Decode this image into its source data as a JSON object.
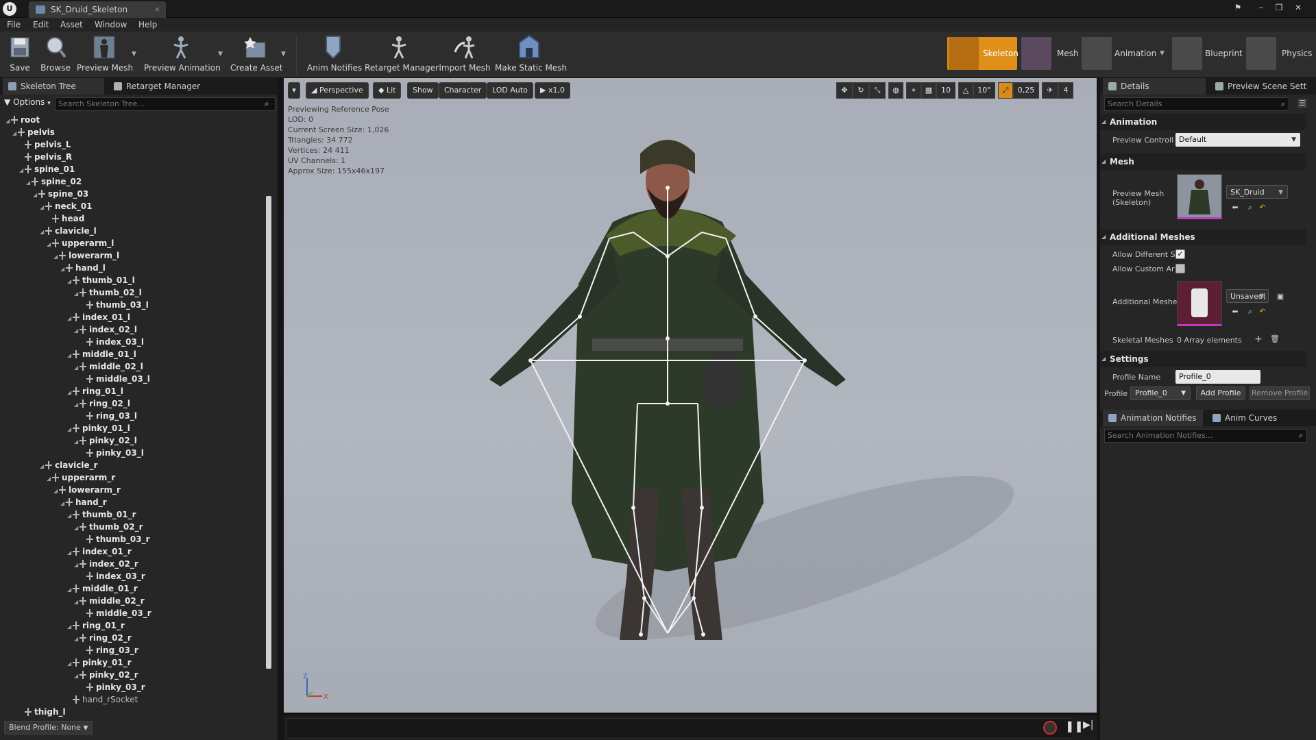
{
  "window": {
    "logo": "U",
    "tab_title": "SK_Druid_Skeleton",
    "tab_close": "×"
  },
  "menu": [
    "File",
    "Edit",
    "Asset",
    "Window",
    "Help"
  ],
  "toolbar": {
    "buttons": [
      {
        "label": "Save",
        "icon": "save-icon"
      },
      {
        "label": "Browse",
        "icon": "browse-icon"
      },
      {
        "label": "Preview Mesh",
        "icon": "preview-mesh-icon"
      },
      {
        "label": "Preview Animation",
        "icon": "preview-animation-icon"
      },
      {
        "label": "Create Asset",
        "icon": "create-asset-icon"
      },
      {
        "label": "Anim Notifies",
        "icon": "anim-notifies-icon"
      },
      {
        "label": "Retarget Manager",
        "icon": "retarget-manager-icon"
      },
      {
        "label": "Import Mesh",
        "icon": "import-mesh-icon"
      },
      {
        "label": "Make Static Mesh",
        "icon": "make-static-mesh-icon"
      }
    ],
    "modes": [
      "Skeleton",
      "Mesh",
      "Animation",
      "Blueprint",
      "Physics"
    ],
    "active_mode": "Skeleton",
    "active_color": "#e0901a"
  },
  "left_panel": {
    "tabs": [
      "Skeleton Tree",
      "Retarget Manager"
    ],
    "options_label": "Options",
    "search_placeholder": "Search Skeleton Tree...",
    "bones": [
      {
        "name": "root",
        "depth": 0
      },
      {
        "name": "pelvis",
        "depth": 1
      },
      {
        "name": "pelvis_L",
        "depth": 2
      },
      {
        "name": "pelvis_R",
        "depth": 2
      },
      {
        "name": "spine_01",
        "depth": 2
      },
      {
        "name": "spine_02",
        "depth": 3
      },
      {
        "name": "spine_03",
        "depth": 4
      },
      {
        "name": "neck_01",
        "depth": 5
      },
      {
        "name": "head",
        "depth": 6
      },
      {
        "name": "clavicle_l",
        "depth": 5
      },
      {
        "name": "upperarm_l",
        "depth": 6
      },
      {
        "name": "lowerarm_l",
        "depth": 7
      },
      {
        "name": "hand_l",
        "depth": 8
      },
      {
        "name": "thumb_01_l",
        "depth": 9
      },
      {
        "name": "thumb_02_l",
        "depth": 10
      },
      {
        "name": "thumb_03_l",
        "depth": 11
      },
      {
        "name": "index_01_l",
        "depth": 9
      },
      {
        "name": "index_02_l",
        "depth": 10
      },
      {
        "name": "index_03_l",
        "depth": 11
      },
      {
        "name": "middle_01_l",
        "depth": 9
      },
      {
        "name": "middle_02_l",
        "depth": 10
      },
      {
        "name": "middle_03_l",
        "depth": 11
      },
      {
        "name": "ring_01_l",
        "depth": 9
      },
      {
        "name": "ring_02_l",
        "depth": 10
      },
      {
        "name": "ring_03_l",
        "depth": 11
      },
      {
        "name": "pinky_01_l",
        "depth": 9
      },
      {
        "name": "pinky_02_l",
        "depth": 10
      },
      {
        "name": "pinky_03_l",
        "depth": 11
      },
      {
        "name": "clavicle_r",
        "depth": 5
      },
      {
        "name": "upperarm_r",
        "depth": 6
      },
      {
        "name": "lowerarm_r",
        "depth": 7
      },
      {
        "name": "hand_r",
        "depth": 8
      },
      {
        "name": "thumb_01_r",
        "depth": 9
      },
      {
        "name": "thumb_02_r",
        "depth": 10
      },
      {
        "name": "thumb_03_r",
        "depth": 11
      },
      {
        "name": "index_01_r",
        "depth": 9
      },
      {
        "name": "index_02_r",
        "depth": 10
      },
      {
        "name": "index_03_r",
        "depth": 11
      },
      {
        "name": "middle_01_r",
        "depth": 9
      },
      {
        "name": "middle_02_r",
        "depth": 10
      },
      {
        "name": "middle_03_r",
        "depth": 11
      },
      {
        "name": "ring_01_r",
        "depth": 9
      },
      {
        "name": "ring_02_r",
        "depth": 10
      },
      {
        "name": "ring_03_r",
        "depth": 11
      },
      {
        "name": "pinky_01_r",
        "depth": 9
      },
      {
        "name": "pinky_02_r",
        "depth": 10
      },
      {
        "name": "pinky_03_r",
        "depth": 11
      },
      {
        "name": "hand_rSocket",
        "depth": 9,
        "socket": true
      },
      {
        "name": "thigh_l",
        "depth": 2
      }
    ],
    "blend_profile": "Blend Profile: None"
  },
  "viewport": {
    "buttons": {
      "menu": "▾",
      "perspective": "Perspective",
      "lit": "Lit",
      "show": "Show",
      "character": "Character",
      "lod": "LOD Auto",
      "speed": "x1,0"
    },
    "snap": {
      "grid": "10",
      "rotation": "10°",
      "scale": "0,25",
      "camera_speed": "4"
    },
    "info": [
      "Previewing Reference Pose",
      "LOD: 0",
      "Current Screen Size: 1,026",
      "Triangles: 34 772",
      "Vertices: 24 411",
      "UV Channels: 1",
      "Approx Size: 155x46x197"
    ],
    "axis": {
      "z": "Z",
      "x": "X"
    }
  },
  "right_panel": {
    "tabs": [
      "Details",
      "Preview Scene Sett"
    ],
    "search_placeholder": "Search Details",
    "sections": {
      "animation": "Animation",
      "mesh": "Mesh",
      "additional_meshes": "Additional Meshes",
      "settings": "Settings"
    },
    "preview_controller_label": "Preview Controll",
    "preview_controller_value": "Default",
    "preview_mesh_label": "Preview Mesh (Skeleton)",
    "preview_mesh_value": "SK_Druid",
    "allow_different_label": "Allow Different S",
    "allow_different_checked": true,
    "allow_custom_label": "Allow Custom Ar",
    "allow_custom_checked": false,
    "additional_mesh_label": "Additional Meshe",
    "additional_mesh_value": "Unsaved(",
    "skeletal_meshes_label": "Skeletal Meshes",
    "skeletal_meshes_value": "0 Array elements",
    "profile_name_label": "Profile Name",
    "profile_name_value": "Profile_0",
    "profile_label": "Profile",
    "profile_value": "Profile_0",
    "add_profile": "Add Profile",
    "remove_profile": "Remove Profile",
    "bottom_tabs": [
      "Animation Notifies",
      "Anim Curves"
    ],
    "notifies_search_placeholder": "Search Animation Notifies..."
  }
}
